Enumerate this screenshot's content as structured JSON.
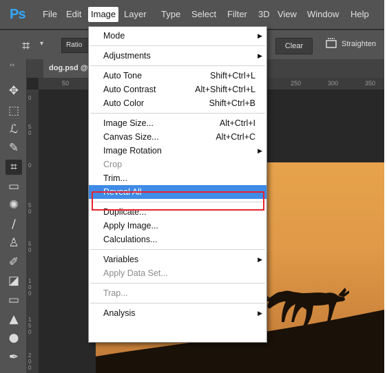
{
  "app": {
    "logo": "Ps"
  },
  "menubar": {
    "items": [
      "File",
      "Edit",
      "Image",
      "Layer",
      "Type",
      "Select",
      "Filter",
      "3D",
      "View",
      "Window",
      "Help"
    ],
    "active": "Image"
  },
  "options_bar": {
    "tool_icon": "crop-icon",
    "ratio_label": "Ratio",
    "clear_label": "Clear",
    "straighten_label": "Straighten",
    "straighten_icon": "straighten-icon"
  },
  "toolbar": {
    "collapse_glyph": "››",
    "tools": [
      {
        "name": "move-tool-icon",
        "glyph": "✥"
      },
      {
        "name": "marquee-tool-icon",
        "glyph": "⬚"
      },
      {
        "name": "lasso-tool-icon",
        "glyph": "ℒ"
      },
      {
        "name": "quick-selection-tool-icon",
        "glyph": "✎"
      },
      {
        "name": "crop-tool-icon",
        "glyph": "⌗",
        "selected": true
      },
      {
        "name": "ruler-tool-icon",
        "glyph": "▭"
      },
      {
        "name": "healing-brush-tool-icon",
        "glyph": "✺"
      },
      {
        "name": "brush-tool-icon",
        "glyph": "∕"
      },
      {
        "name": "clone-stamp-tool-icon",
        "glyph": "♙"
      },
      {
        "name": "history-brush-tool-icon",
        "glyph": "✐"
      },
      {
        "name": "eraser-tool-icon",
        "glyph": "◪"
      },
      {
        "name": "gradient-tool-icon",
        "glyph": "▭"
      },
      {
        "name": "blur-tool-icon",
        "glyph": "▲"
      },
      {
        "name": "dodge-tool-icon",
        "glyph": "●"
      },
      {
        "name": "pen-tool-icon",
        "glyph": "✒"
      }
    ]
  },
  "document": {
    "tab_title": "dog.psd @"
  },
  "rulers": {
    "horizontal_ticks": [
      "50",
      "250",
      "300",
      "350"
    ],
    "vertical_labels": [
      "0",
      "50",
      "0",
      "50",
      "50",
      "100",
      "150",
      "200",
      "250"
    ]
  },
  "image_menu": {
    "items": [
      {
        "label": "Mode",
        "submenu": true
      },
      {
        "sep": true
      },
      {
        "label": "Adjustments",
        "submenu": true
      },
      {
        "sep": true
      },
      {
        "label": "Auto Tone",
        "shortcut": "Shift+Ctrl+L"
      },
      {
        "label": "Auto Contrast",
        "shortcut": "Alt+Shift+Ctrl+L"
      },
      {
        "label": "Auto Color",
        "shortcut": "Shift+Ctrl+B"
      },
      {
        "sep": true
      },
      {
        "label": "Image Size...",
        "shortcut": "Alt+Ctrl+I"
      },
      {
        "label": "Canvas Size...",
        "shortcut": "Alt+Ctrl+C"
      },
      {
        "label": "Image Rotation",
        "submenu": true
      },
      {
        "label": "Crop",
        "disabled": true
      },
      {
        "label": "Trim..."
      },
      {
        "label": "Reveal All",
        "highlighted": true
      },
      {
        "sep": true
      },
      {
        "label": "Duplicate..."
      },
      {
        "label": "Apply Image..."
      },
      {
        "label": "Calculations..."
      },
      {
        "sep": true
      },
      {
        "label": "Variables",
        "submenu": true
      },
      {
        "label": "Apply Data Set...",
        "disabled": true
      },
      {
        "sep": true
      },
      {
        "label": "Trap...",
        "disabled": true
      },
      {
        "sep": true
      },
      {
        "label": "Analysis",
        "submenu": true
      }
    ]
  },
  "colors": {
    "highlight": "#3f8be6",
    "callout_border": "#e8232e",
    "photo_sky": "#e09a48"
  }
}
